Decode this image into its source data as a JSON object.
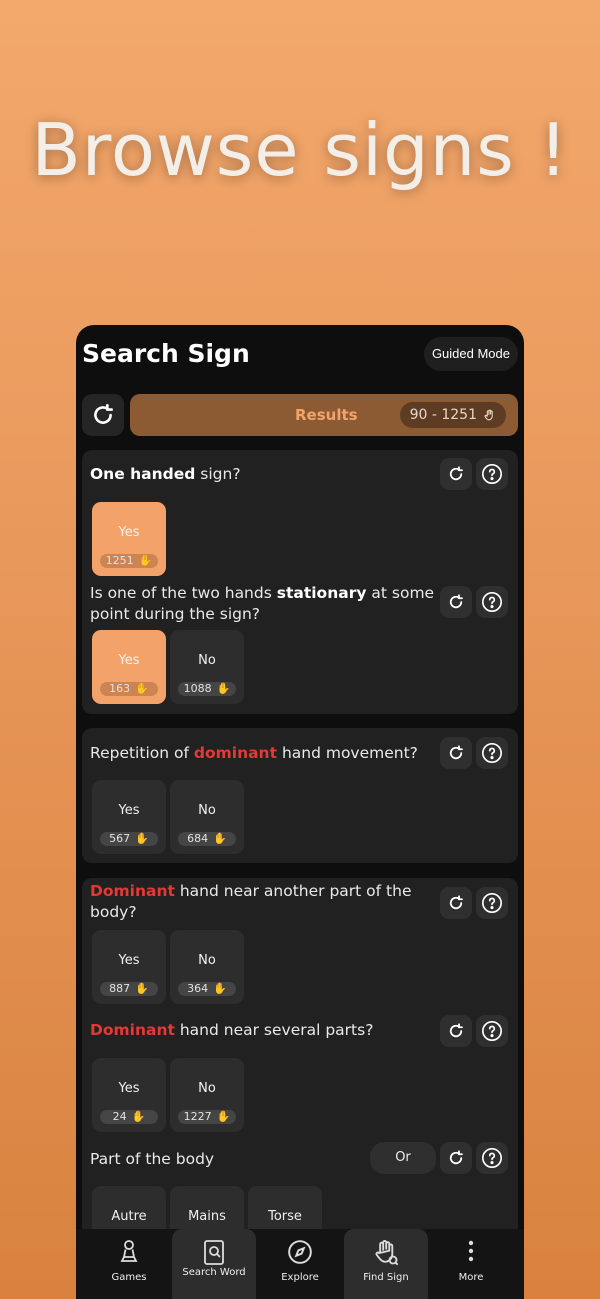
{
  "banner": "Browse signs !",
  "header": {
    "title": "Search Sign",
    "guided_mode": "Guided Mode"
  },
  "results": {
    "label": "Results",
    "count": "90 - 1251"
  },
  "questions": {
    "q1": {
      "bold": "One handed",
      "rest": " sign?",
      "yes": "Yes",
      "yes_count": "1251"
    },
    "q2": {
      "pre": "Is one of the two hands ",
      "bold": "stationary",
      "post": " at some point during the sign?",
      "yes": "Yes",
      "yes_count": "163",
      "no": "No",
      "no_count": "1088"
    },
    "q3": {
      "pre": "Repetition of ",
      "red": "dominant",
      "post": " hand movement?",
      "yes": "Yes",
      "yes_count": "567",
      "no": "No",
      "no_count": "684"
    },
    "q4": {
      "red": "Dominant",
      "post": " hand near another part of the body?",
      "yes": "Yes",
      "yes_count": "887",
      "no": "No",
      "no_count": "364"
    },
    "q5": {
      "red": "Dominant",
      "post": " hand near several parts?",
      "yes": "Yes",
      "yes_count": "24",
      "no": "No",
      "no_count": "1227"
    },
    "q6": {
      "label": "Part of the body",
      "or": "Or",
      "options": [
        "Autre",
        "Mains",
        "Torse"
      ]
    }
  },
  "nav": {
    "games": "Games",
    "search_word": "Search Word",
    "explore": "Explore",
    "find_sign": "Find Sign",
    "more": "More"
  },
  "colors": {
    "accent": "#f3a36a",
    "red": "#e53935",
    "background": "#0e0e0e"
  }
}
